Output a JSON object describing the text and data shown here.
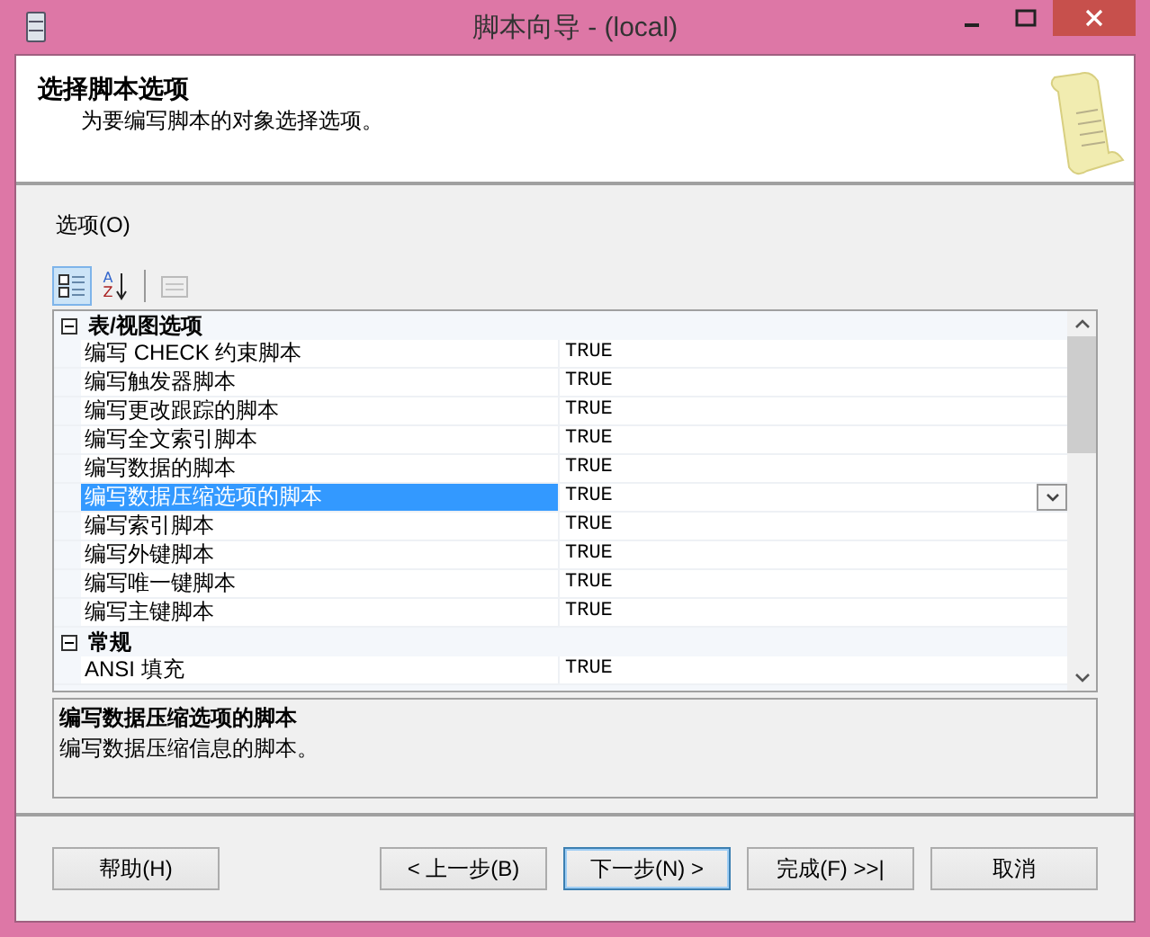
{
  "window": {
    "title": "脚本向导 - (local)"
  },
  "header": {
    "title": "选择脚本选项",
    "subtitle": "为要编写脚本的对象选择选项。"
  },
  "options_label": "选项(O)",
  "toolbar": [
    {
      "kind": "categorized",
      "selected": true
    },
    {
      "kind": "alphabetical",
      "selected": false,
      "letters": [
        "A",
        "Z"
      ]
    },
    {
      "kind": "pages",
      "disabled": true
    }
  ],
  "property_grid": {
    "categories": [
      {
        "name": "表/视图选项",
        "expanded": true,
        "properties": [
          {
            "name": "编写 CHECK 约束脚本",
            "value": "TRUE",
            "selected": false
          },
          {
            "name": "编写触发器脚本",
            "value": "TRUE",
            "selected": false
          },
          {
            "name": "编写更改跟踪的脚本",
            "value": "TRUE",
            "selected": false
          },
          {
            "name": "编写全文索引脚本",
            "value": "TRUE",
            "selected": false
          },
          {
            "name": "编写数据的脚本",
            "value": "TRUE",
            "selected": false
          },
          {
            "name": "编写数据压缩选项的脚本",
            "value": "TRUE",
            "selected": true
          },
          {
            "name": "编写索引脚本",
            "value": "TRUE",
            "selected": false
          },
          {
            "name": "编写外键脚本",
            "value": "TRUE",
            "selected": false
          },
          {
            "name": "编写唯一键脚本",
            "value": "TRUE",
            "selected": false
          },
          {
            "name": "编写主键脚本",
            "value": "TRUE",
            "selected": false
          }
        ]
      },
      {
        "name": "常规",
        "expanded": true,
        "properties": [
          {
            "name": "ANSI 填充",
            "value": "TRUE",
            "selected": false
          }
        ]
      }
    ]
  },
  "description": {
    "title": "编写数据压缩选项的脚本",
    "text": "编写数据压缩信息的脚本。"
  },
  "buttons": [
    {
      "label": "帮助(H)",
      "default": false
    },
    {
      "label": "< 上一步(B)",
      "default": false
    },
    {
      "label": "下一步(N) >",
      "default": true
    },
    {
      "label": "完成(F) >>|",
      "default": false
    },
    {
      "label": "取消",
      "default": false
    }
  ]
}
